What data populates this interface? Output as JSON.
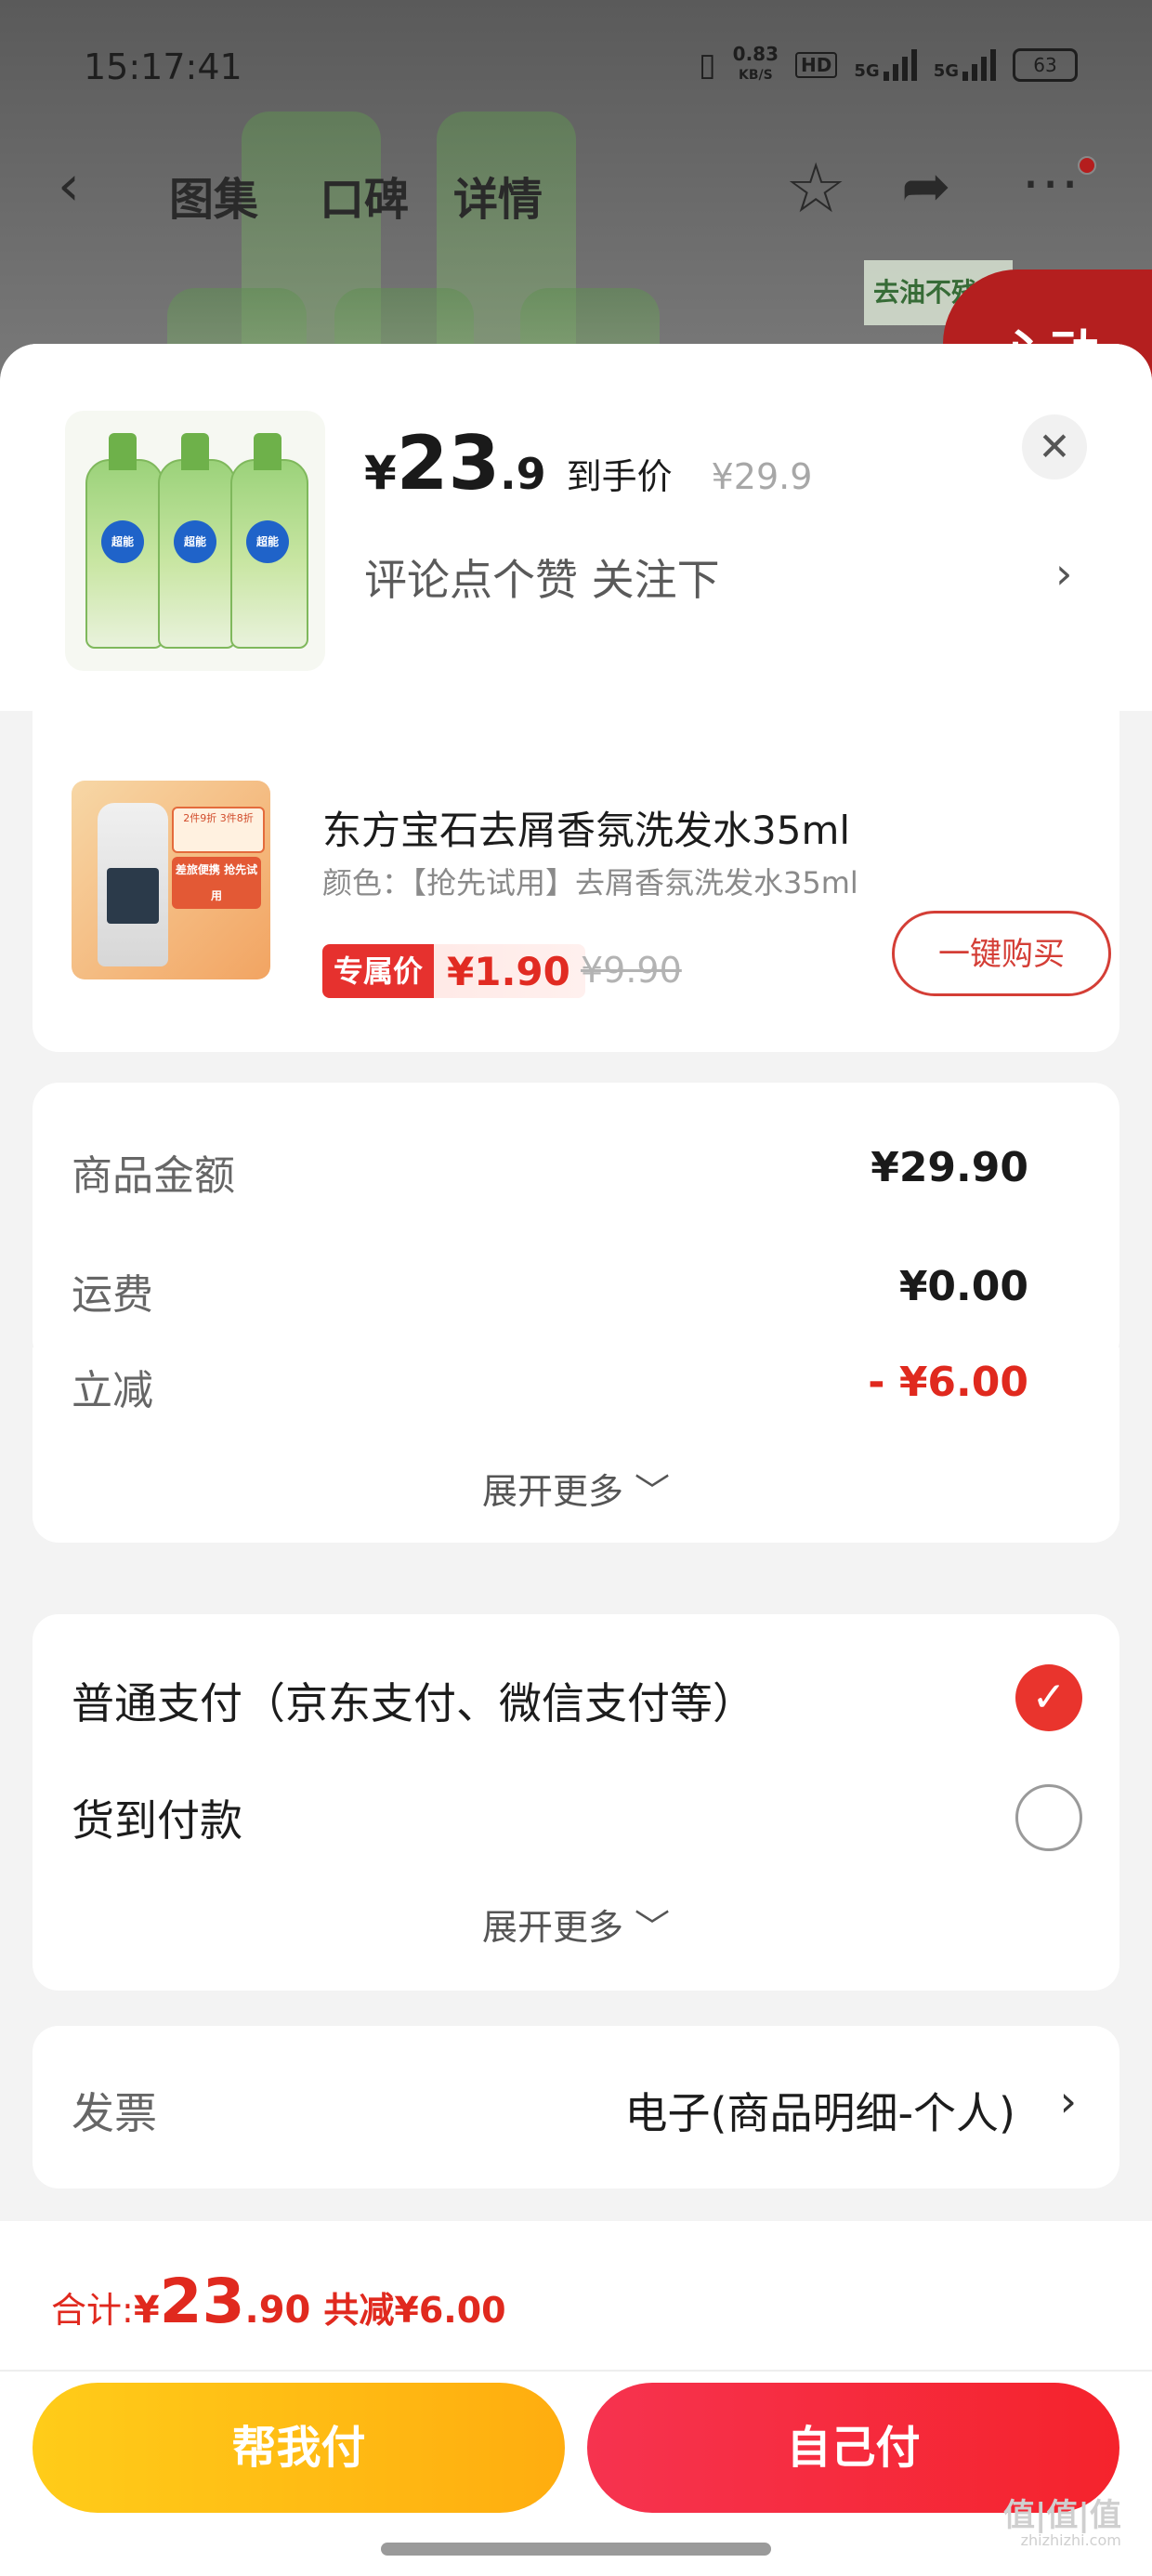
{
  "status_bar": {
    "time": "15:17:41",
    "net_speed": "0.83",
    "net_unit": "KB/S",
    "hd": "HD",
    "sig1": "5G",
    "sig2": "5G",
    "battery": "63"
  },
  "nav": {
    "tabs": [
      {
        "label": "图集"
      },
      {
        "label": "口碑"
      },
      {
        "label": "详情"
      }
    ],
    "icons": [
      "back-icon",
      "star-icon",
      "share-icon",
      "more-icon"
    ]
  },
  "background_promo": {
    "tag": "去油不残留",
    "red_badge": "心动"
  },
  "product": {
    "currency": "¥",
    "price_int": "23",
    "price_dec": ".9",
    "price_tag": "到手价",
    "orig_price": "¥29.9",
    "follow_text": "评论点个赞  关注下",
    "brand_badge": "超能"
  },
  "gift_item": {
    "title": "东方宝石去屑香氛洗发水35ml",
    "spec": "颜色：【抢先试用】去屑香氛洗发水35ml",
    "badge_top": "2件9折 3件8折",
    "badge_bottom": "差旅便携 抢先试用",
    "exclusive_label": "专属价",
    "exclusive_price": "¥1.90",
    "orig_price": "¥9.90",
    "buy_label": "一键购买"
  },
  "amounts": {
    "rows": [
      {
        "label": "商品金额",
        "value": "¥29.90"
      },
      {
        "label": "运费",
        "value": "¥0.00"
      },
      {
        "label": "立减",
        "value": "- ¥6.00"
      }
    ],
    "expand": "展开更多 ﹀"
  },
  "payment": {
    "options": [
      {
        "label": "普通支付（京东支付、微信支付等）",
        "selected": true
      },
      {
        "label": "货到付款",
        "selected": false
      }
    ],
    "expand": "展开更多 ﹀"
  },
  "invoice": {
    "label": "发票",
    "value": "电子(商品明细-个人)"
  },
  "footer": {
    "total_label": "合计: ",
    "total_cur": "¥",
    "total_int": "23",
    "total_dec": ".90",
    "total_save": "共减¥6.00",
    "btn_friend": "帮我付",
    "btn_self": "自己付"
  },
  "watermark": {
    "text": "值|值|值",
    "sub": "zhizhizhi.com"
  },
  "colors": {
    "accent_red": "#e0291e",
    "yellow": "#ffbb14",
    "check_red": "#e9342d"
  }
}
